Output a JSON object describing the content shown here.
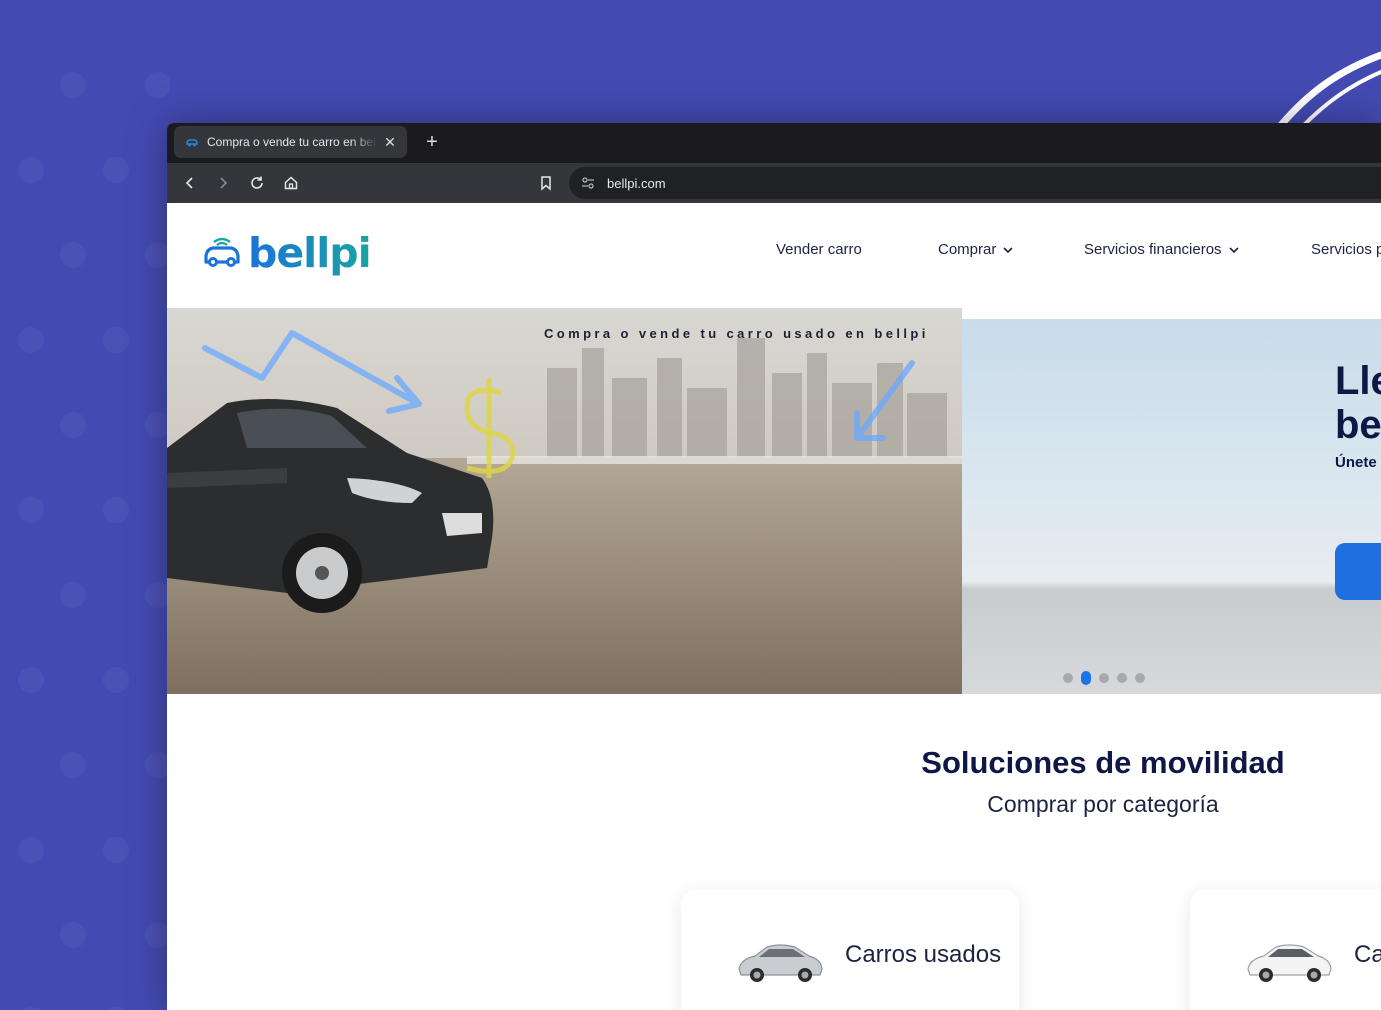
{
  "browser": {
    "tab": {
      "title": "Compra o vende tu carro en bellpi",
      "close_label": "✕"
    },
    "new_tab_label": "+",
    "url": "bellpi.com"
  },
  "site": {
    "logo_text": "bellpi",
    "nav": [
      {
        "label": "Vender carro",
        "has_dropdown": false
      },
      {
        "label": "Comprar",
        "has_dropdown": true
      },
      {
        "label": "Servicios financieros",
        "has_dropdown": true
      },
      {
        "label": "Servicios p",
        "has_dropdown": false
      }
    ]
  },
  "hero": {
    "caption": "Compra o vende tu carro usado en bellpi",
    "right_heading_line1": "Lle",
    "right_heading_line2": "be",
    "right_subtext": "Únete",
    "carousel": {
      "count": 5,
      "active_index": 1
    }
  },
  "section": {
    "title": "Soluciones de movilidad",
    "subtitle": "Comprar por categoría"
  },
  "categories": [
    {
      "label": "Carros usados"
    },
    {
      "label": "Ca"
    }
  ],
  "colors": {
    "background": "#434bb3",
    "brand_blue": "#1c73d8",
    "brand_teal": "#19a6a0",
    "heading": "#0e1746",
    "active_dot": "#1a73e8"
  }
}
